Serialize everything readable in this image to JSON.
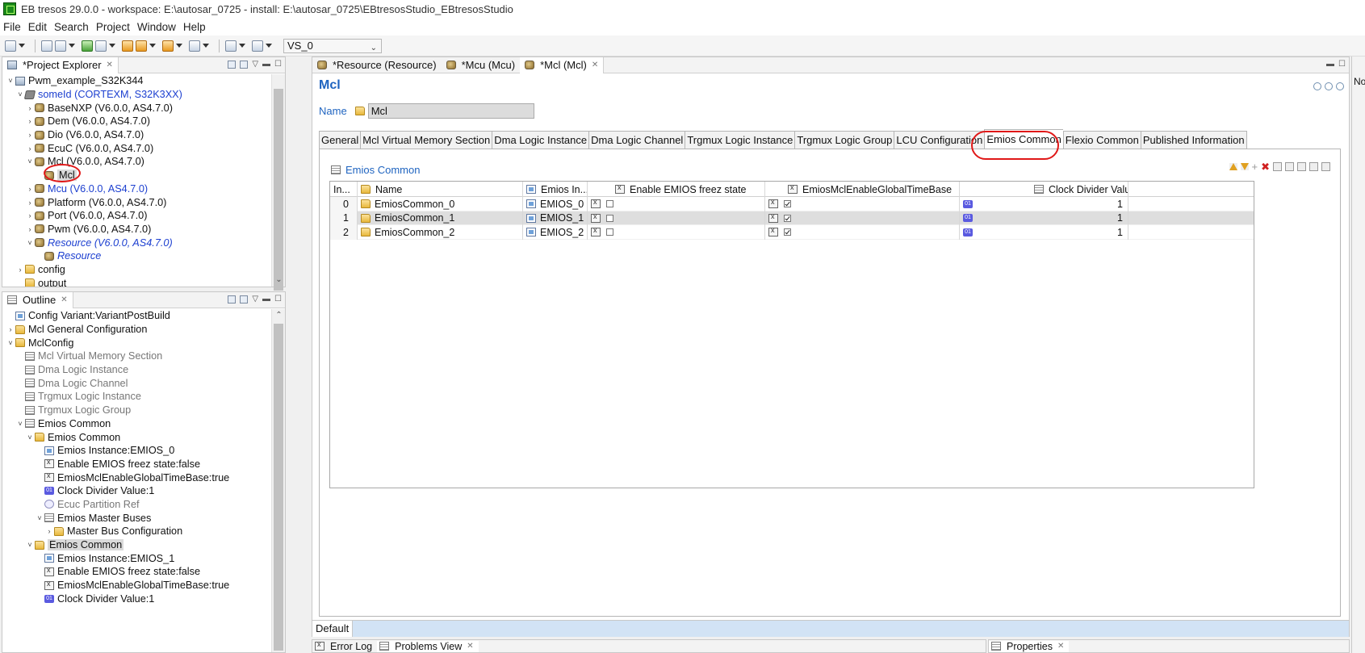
{
  "window": {
    "title": "EB tresos 29.0.0 - workspace: E:\\autosar_0725 - install: E:\\autosar_0725\\EBtresosStudio_EBtresosStudio"
  },
  "menu": [
    "File",
    "Edit",
    "Search",
    "Project",
    "Window",
    "Help"
  ],
  "toolbar": {
    "variant_select": "VS_0",
    "select_icon": "chevron-down-icon"
  },
  "project_explorer": {
    "tab_label": "*Project Explorer",
    "items": [
      {
        "label": "Pwm_example_S32K344",
        "arrow": "˅",
        "icon": "project",
        "style": ""
      },
      {
        "label": "someId (CORTEXM, S32K3XX)",
        "arrow": "˅",
        "icon": "ecu",
        "style": "blue"
      },
      {
        "label": "BaseNXP (V6.0.0, AS4.7.0)",
        "arrow": "›",
        "icon": "module",
        "style": ""
      },
      {
        "label": "Dem (V6.0.0, AS4.7.0)",
        "arrow": "›",
        "icon": "module",
        "style": ""
      },
      {
        "label": "Dio (V6.0.0, AS4.7.0)",
        "arrow": "›",
        "icon": "module",
        "style": ""
      },
      {
        "label": "EcuC (V6.0.0, AS4.7.0)",
        "arrow": "›",
        "icon": "module",
        "style": ""
      },
      {
        "label": "Mcl (V6.0.0, AS4.7.0)",
        "arrow": "˅",
        "icon": "module",
        "style": ""
      },
      {
        "label": "Mcl",
        "arrow": "",
        "icon": "module",
        "style": "sel"
      },
      {
        "label": "Mcu (V6.0.0, AS4.7.0)",
        "arrow": "›",
        "icon": "module",
        "style": "blue"
      },
      {
        "label": "Platform (V6.0.0, AS4.7.0)",
        "arrow": "›",
        "icon": "module",
        "style": ""
      },
      {
        "label": "Port (V6.0.0, AS4.7.0)",
        "arrow": "›",
        "icon": "module",
        "style": ""
      },
      {
        "label": "Pwm (V6.0.0, AS4.7.0)",
        "arrow": "›",
        "icon": "module",
        "style": ""
      },
      {
        "label": "Resource (V6.0.0, AS4.7.0)",
        "arrow": "˅",
        "icon": "module",
        "style": "ital"
      },
      {
        "label": "Resource",
        "arrow": "",
        "icon": "module",
        "style": "ital"
      },
      {
        "label": "config",
        "arrow": "›",
        "icon": "folder",
        "style": ""
      },
      {
        "label": "output",
        "arrow": "",
        "icon": "folder",
        "style": ""
      }
    ]
  },
  "outline": {
    "tab_label": "Outline",
    "items": [
      {
        "label": "Config Variant:VariantPostBuild",
        "arrow": "",
        "icon": "config",
        "style": ""
      },
      {
        "label": "Mcl General Configuration",
        "arrow": "›",
        "icon": "folder",
        "style": ""
      },
      {
        "label": "MclConfig",
        "arrow": "˅",
        "icon": "folder",
        "style": ""
      },
      {
        "label": "Mcl Virtual Memory Section",
        "arrow": "",
        "icon": "list",
        "style": "gray"
      },
      {
        "label": "Dma Logic Instance",
        "arrow": "",
        "icon": "list",
        "style": "gray"
      },
      {
        "label": "Dma Logic Channel",
        "arrow": "",
        "icon": "list",
        "style": "gray"
      },
      {
        "label": "Trgmux Logic Instance",
        "arrow": "",
        "icon": "list",
        "style": "gray"
      },
      {
        "label": "Trgmux Logic Group",
        "arrow": "",
        "icon": "list",
        "style": "gray"
      },
      {
        "label": "Emios Common",
        "arrow": "˅",
        "icon": "list",
        "style": ""
      },
      {
        "label": "Emios Common",
        "arrow": "˅",
        "icon": "folder",
        "style": ""
      },
      {
        "label": "Emios Instance:EMIOS_0",
        "arrow": "",
        "icon": "config",
        "style": ""
      },
      {
        "label": "Enable EMIOS freez state:false",
        "arrow": "",
        "icon": "param",
        "style": ""
      },
      {
        "label": "EmiosMclEnableGlobalTimeBase:true",
        "arrow": "",
        "icon": "param",
        "style": ""
      },
      {
        "label": "Clock Divider Value:1",
        "arrow": "",
        "icon": "num",
        "style": ""
      },
      {
        "label": "Ecuc Partition Ref",
        "arrow": "",
        "icon": "ref",
        "style": "gray"
      },
      {
        "label": "Emios Master Buses",
        "arrow": "˅",
        "icon": "list",
        "style": ""
      },
      {
        "label": "Master Bus Configuration",
        "arrow": "›",
        "icon": "folder",
        "style": ""
      },
      {
        "label": "Emios Common",
        "arrow": "˅",
        "icon": "folder",
        "style": "sel"
      },
      {
        "label": "Emios Instance:EMIOS_1",
        "arrow": "",
        "icon": "config",
        "style": ""
      },
      {
        "label": "Enable EMIOS freez state:false",
        "arrow": "",
        "icon": "param",
        "style": ""
      },
      {
        "label": "EmiosMclEnableGlobalTimeBase:true",
        "arrow": "",
        "icon": "param",
        "style": ""
      },
      {
        "label": "Clock Divider Value:1",
        "arrow": "",
        "icon": "num",
        "style": ""
      }
    ]
  },
  "editor": {
    "tabs": [
      {
        "label": "*Resource (Resource)",
        "active": false
      },
      {
        "label": "*Mcu (Mcu)",
        "active": false
      },
      {
        "label": "*Mcl (Mcl)",
        "active": true
      }
    ],
    "title": "Mcl",
    "name_label": "Name",
    "name_value": "Mcl",
    "section_tabs": [
      {
        "label": "General",
        "active": false
      },
      {
        "label": "Mcl Virtual Memory Section",
        "active": false
      },
      {
        "label": "Dma Logic Instance",
        "active": false
      },
      {
        "label": "Dma Logic Channel",
        "active": false
      },
      {
        "label": "Trgmux Logic Instance",
        "active": false
      },
      {
        "label": "Trgmux Logic Group",
        "active": false
      },
      {
        "label": "LCU Configuration",
        "active": false
      },
      {
        "label": "Emios Common",
        "active": true
      },
      {
        "label": "Flexio Common",
        "active": false
      },
      {
        "label": "Published Information",
        "active": false
      }
    ],
    "section_title": "Emios Common",
    "table": {
      "columns": [
        "In...",
        "Name",
        "Emios In...",
        "Enable EMIOS freez state",
        "EmiosMclEnableGlobalTimeBase",
        "Clock Divider Value"
      ],
      "rows": [
        {
          "index": "0",
          "name": "EmiosCommon_0",
          "instance": "EMIOS_0",
          "freeze": false,
          "global_timebase": true,
          "clock_divider": "1"
        },
        {
          "index": "1",
          "name": "EmiosCommon_1",
          "instance": "EMIOS_1",
          "freeze": false,
          "global_timebase": true,
          "clock_divider": "1"
        },
        {
          "index": "2",
          "name": "EmiosCommon_2",
          "instance": "EMIOS_2",
          "freeze": false,
          "global_timebase": true,
          "clock_divider": "1"
        }
      ],
      "selected_row": 1
    },
    "variant_label": "Default"
  },
  "bottom_left": {
    "tabs": [
      {
        "label": "Error Log",
        "active": false
      },
      {
        "label": "Problems View",
        "active": true
      }
    ]
  },
  "bottom_right": {
    "tab_label": "Properties"
  },
  "right_strip": {
    "label": "No"
  },
  "colors": {
    "accent": "#1f64c0",
    "highlight": "#e01818",
    "variant_bar": "#d2e3f5"
  }
}
